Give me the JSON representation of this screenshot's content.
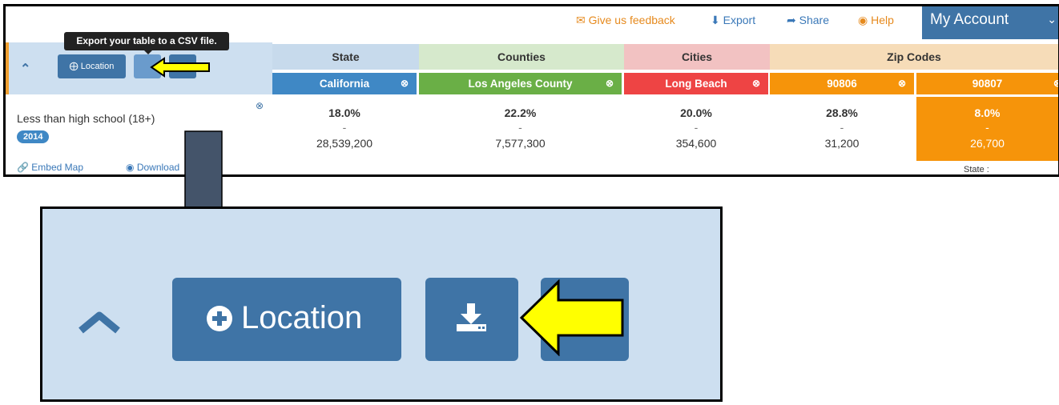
{
  "top_bar": {
    "feedback": "Give us feedback",
    "export": "Export",
    "share": "Share",
    "help": "Help",
    "account": "My Account"
  },
  "tooltip": "Export your table to a CSV file.",
  "toolbar": {
    "location_label": "Location"
  },
  "columns": {
    "state_header": "State",
    "counties_header": "Counties",
    "cities_header": "Cities",
    "zip_header": "Zip Codes"
  },
  "places": [
    "California",
    "Los Angeles County",
    "Long Beach",
    "90806",
    "90807"
  ],
  "row": {
    "label": "Less than high school (18+)",
    "year": "2014",
    "pct": [
      "18.0%",
      "22.2%",
      "20.0%",
      "28.8%",
      "8.0%"
    ],
    "dash": [
      "-",
      "-",
      "-",
      "-",
      "-"
    ],
    "count": [
      "28,539,200",
      "7,577,300",
      "354,600",
      "31,200",
      "26,700"
    ]
  },
  "footer": {
    "embed": "Embed Map",
    "download": "Download",
    "state_note": "State :"
  },
  "zoom": {
    "location_label": "Location"
  },
  "colors": {
    "state": "#3f88c5",
    "counties": "#6aaf46",
    "cities": "#ee4444",
    "zip": "#f6940a",
    "state_hdr": "#c7daec",
    "counties_hdr": "#d6e9cc",
    "cities_hdr": "#f2c2c2",
    "zip_hdr": "#f6dcb8",
    "button": "#3f74a6",
    "panel": "#cddff0",
    "arrow_fill": "#ffff00"
  }
}
